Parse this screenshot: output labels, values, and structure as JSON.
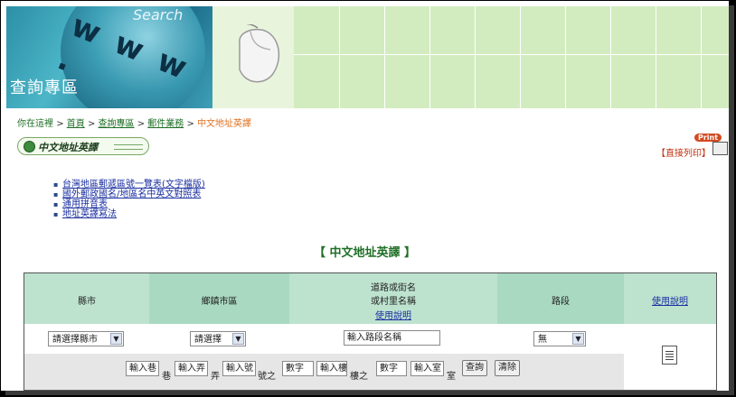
{
  "banner": {
    "search_word": "Search",
    "title": "查詢專區",
    "www_text": "w w w ."
  },
  "breadcrumb": {
    "you_are_here": "你在這裡",
    "sep": ">",
    "items": [
      "首頁",
      "查詢專區",
      "郵件業務"
    ],
    "current": "中文地址英譯"
  },
  "section": {
    "title": "中文地址英譯"
  },
  "print": {
    "badge": "Print",
    "label": "【直接列印】"
  },
  "links": [
    "台灣地區郵遞區號一覽表(文字檔版)",
    "國外郵政國名/地區名中英文對照表",
    "通用拼音表",
    "地址英譯寫法"
  ],
  "tool": {
    "title": "【 中文地址英譯 】",
    "headers": {
      "county": "縣市",
      "town": "鄉鎮市區",
      "road_line1": "道路或街名",
      "road_line2": "或村里名稱",
      "road_help": "使用說明",
      "section": "路段",
      "help": "使用說明"
    },
    "county_select": "請選擇縣市",
    "town_select": "請選擇",
    "road_input_placeholder": "輸入路段名稱",
    "section_select": "無",
    "row3": {
      "lane_ph": "輸入巷",
      "lane_unit": "巷",
      "alley_ph": "輸入弄",
      "alley_unit": "弄",
      "no_ph": "輸入號",
      "no_unit": "號之",
      "no_sub_ph": "數字",
      "floor_ph": "輸入樓",
      "floor_unit": "樓之",
      "floor_sub_ph": "數字",
      "room_ph": "輸入室",
      "room_unit": "室",
      "query_button": "查詢",
      "clear_button": "清除"
    }
  },
  "icons": {
    "record_dot": "circle-icon",
    "printer": "printer-icon",
    "document": "document-icon",
    "dropdown": "chevron-down-icon"
  },
  "colors": {
    "banner_green": "#d2ecc0",
    "header_green": "#bde3cf",
    "link_blue": "#1a2ea0",
    "title_green": "#1f6f26",
    "current_orange": "#e07020"
  }
}
